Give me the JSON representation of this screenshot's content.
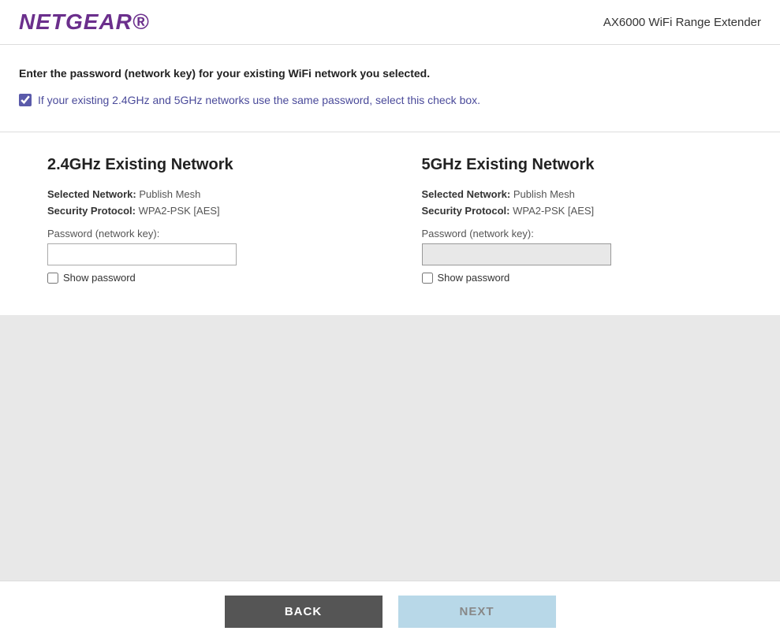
{
  "header": {
    "logo": "NETGEAR®",
    "device_name": "AX6000 WiFi Range Extender"
  },
  "main": {
    "instruction": "Enter the password (network key) for your existing WiFi network you selected.",
    "checkbox_label": "If your existing 2.4GHz and 5GHz networks use the same password, select this check box.",
    "checkbox_checked": true
  },
  "networks": [
    {
      "id": "network-24ghz",
      "title": "2.4GHz Existing Network",
      "selected_network_label": "Selected Network:",
      "selected_network_value": "Publish Mesh",
      "security_protocol_label": "Security Protocol:",
      "security_protocol_value": "WPA2-PSK [AES]",
      "password_label": "Password (network key):",
      "password_value": "",
      "show_password_label": "Show password",
      "show_password_checked": false
    },
    {
      "id": "network-5ghz",
      "title": "5GHz Existing Network",
      "selected_network_label": "Selected Network:",
      "selected_network_value": "Publish Mesh",
      "security_protocol_label": "Security Protocol:",
      "security_protocol_value": "WPA2-PSK [AES]",
      "password_label": "Password (network key):",
      "password_value": "",
      "show_password_label": "Show password",
      "show_password_checked": false
    }
  ],
  "footer": {
    "back_label": "BACK",
    "next_label": "NEXT"
  }
}
